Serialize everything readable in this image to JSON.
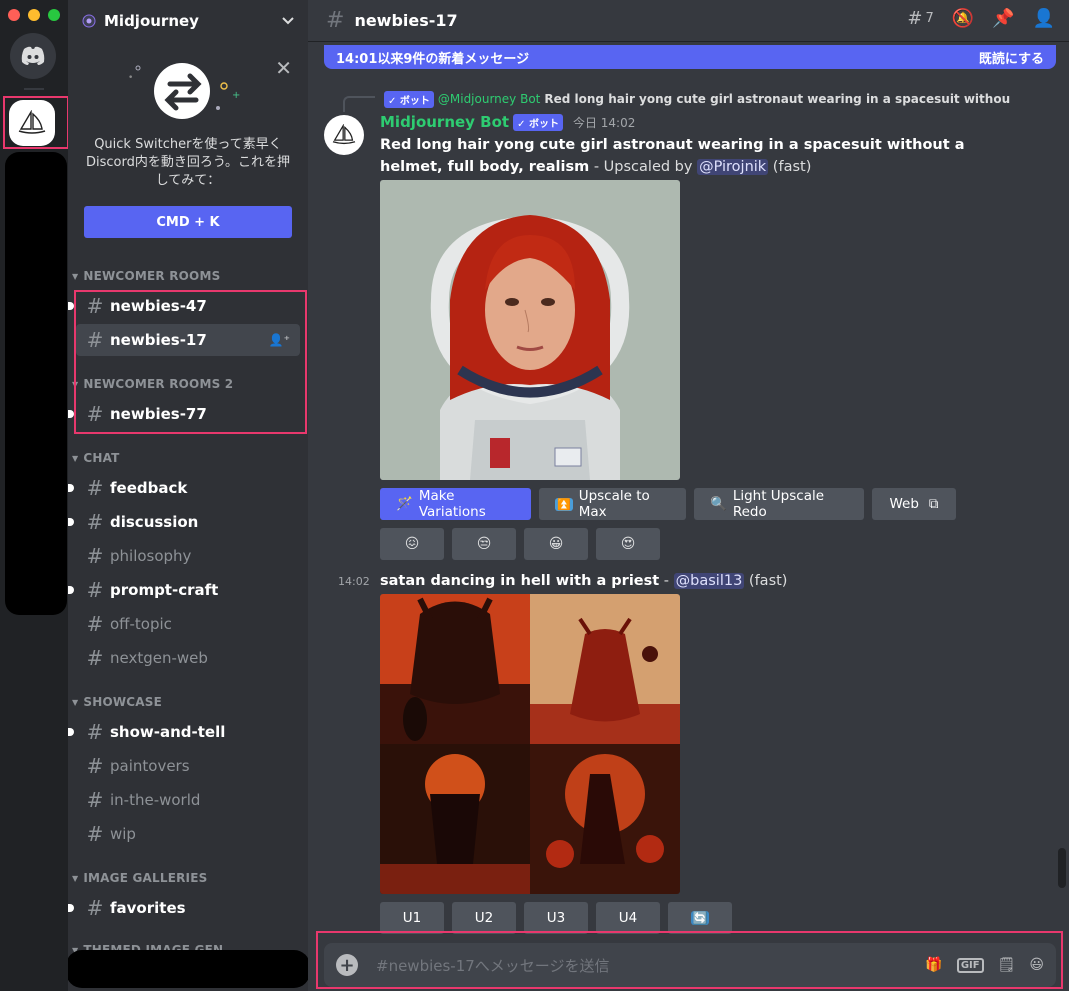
{
  "server": {
    "name": "Midjourney"
  },
  "quick_switcher": {
    "text": "Quick Switcherを使って素早くDiscord内を動き回ろう。これを押してみて：",
    "button": "CMD + K"
  },
  "categories": {
    "newcomer_rooms": "NEWCOMER ROOMS",
    "newcomer_rooms_2": "NEWCOMER ROOMS 2",
    "chat": "CHAT",
    "showcase": "SHOWCASE",
    "image_galleries": "IMAGE GALLERIES",
    "themed": "THEMED IMAGE GEN"
  },
  "channels": {
    "newbies_47": "newbies-47",
    "newbies_17": "newbies-17",
    "newbies_77": "newbies-77",
    "feedback": "feedback",
    "discussion": "discussion",
    "philosophy": "philosophy",
    "prompt_craft": "prompt-craft",
    "off_topic": "off-topic",
    "nextgen_web": "nextgen-web",
    "show_and_tell": "show-and-tell",
    "paintovers": "paintovers",
    "in_the_world": "in-the-world",
    "wip": "wip",
    "favorites": "favorites"
  },
  "header": {
    "channel": "newbies-17",
    "threads_count": "7"
  },
  "new_messages": {
    "text": "14:01以来9件の新着メッセージ",
    "mark_read": "既読にする"
  },
  "message1": {
    "reply_author": "@Midjourney Bot",
    "reply_text": "Red long hair yong cute girl astronaut wearing in a spacesuit without ...",
    "bot_badge": "✓ ボット",
    "author": "Midjourney Bot",
    "timestamp": "今日 14:02",
    "prompt": "Red long hair yong cute girl astronaut wearing in a spacesuit without a helmet, full body, realism",
    "suffix": " - Upscaled by ",
    "mention": "@Pirojnik",
    "speed": " (fast)",
    "buttons": {
      "make_variations": "Make Variations",
      "upscale_max": "Upscale to Max",
      "light_upscale": "Light Upscale Redo",
      "web": "Web"
    }
  },
  "message2": {
    "timestamp": "14:02",
    "prompt": "satan dancing in hell with a priest",
    "dash": " - ",
    "mention": "@basil13",
    "speed": " (fast)",
    "buttons": {
      "u1": "U1",
      "u2": "U2",
      "u3": "U3",
      "u4": "U4"
    }
  },
  "input": {
    "placeholder": "#newbies-17へメッセージを送信"
  },
  "colors": {
    "accent": "#5865f2",
    "highlight": "#e8386d",
    "bot_name": "#2ecc71"
  }
}
